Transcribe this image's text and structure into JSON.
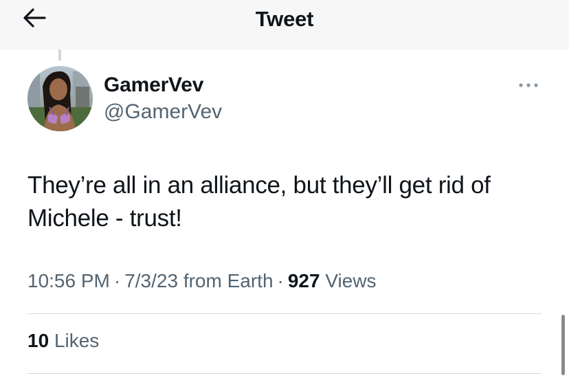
{
  "header": {
    "title": "Tweet",
    "back_icon": "arrow-left-icon"
  },
  "tweet": {
    "author": {
      "display_name": "GamerVev",
      "handle": "@GamerVev",
      "avatar": "profile-photo"
    },
    "more_icon": "more-horizontal-icon",
    "text_line1": "They’re all in an alliance, but they’ll get rid of",
    "text_line2": "Michele - trust!",
    "time": "10:56 PM",
    "date": "7/3/23",
    "source": "from Earth",
    "views_count": "927",
    "views_label": "Views",
    "likes_count": "10",
    "likes_label": "Likes"
  },
  "colors": {
    "text_primary": "#0f1419",
    "text_secondary": "#536471",
    "divider": "#cfd9de",
    "header_bg": "#f7f7f7"
  }
}
